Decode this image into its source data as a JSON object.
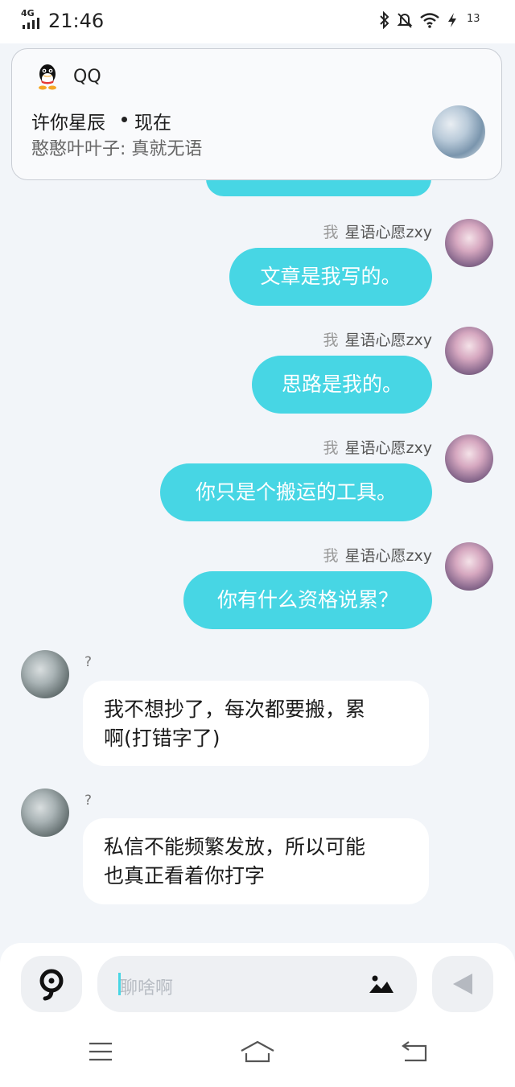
{
  "status_bar": {
    "network": "4G",
    "time": "21:46",
    "battery": "13",
    "icons": [
      "bluetooth-icon",
      "mute-bell-icon",
      "wifi-icon",
      "charging-icon"
    ]
  },
  "notification": {
    "app_name": "QQ",
    "sender": "许你星辰",
    "time": "现在",
    "message": "憨憨叶叶子: 真就无语"
  },
  "chat": {
    "outgoing": [
      {
        "me_tag": "我",
        "name": "星语心愿zxy",
        "text": "文章是我写的。"
      },
      {
        "me_tag": "我",
        "name": "星语心愿zxy",
        "text": "思路是我的。"
      },
      {
        "me_tag": "我",
        "name": "星语心愿zxy",
        "text": "你只是个搬运的工具。"
      },
      {
        "me_tag": "我",
        "name": "星语心愿zxy",
        "text": "你有什么资格说累？"
      }
    ],
    "incoming": [
      {
        "name": "?",
        "line1": "我不想抄了，每次都要搬，累",
        "line2": "啊(打错字了)"
      },
      {
        "name": "?",
        "line1": "私信不能频繁发放，所以可能",
        "line2": "也真正看着你打字"
      }
    ]
  },
  "input": {
    "placeholder": "聊啥啊"
  },
  "colors": {
    "accent": "#47d6e4",
    "background": "#f2f5f9",
    "bubble_in": "#ffffff"
  }
}
